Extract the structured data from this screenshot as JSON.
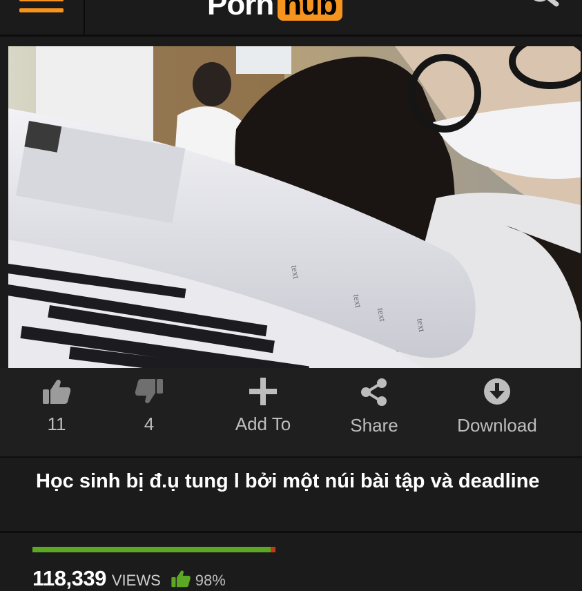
{
  "header": {
    "logo_left": "Porn",
    "logo_right": "hub",
    "icons": {
      "menu": "hamburger-menu-icon",
      "search": "search-icon"
    },
    "accent_color": "#f7941d"
  },
  "video": {
    "description": "selfie photo of students in white uniforms behind a stack of papers"
  },
  "actions": [
    {
      "icon": "thumbs-up-icon",
      "label": "11"
    },
    {
      "icon": "thumbs-down-icon",
      "label": "4"
    },
    {
      "icon": "plus-icon",
      "label": "Add To"
    },
    {
      "icon": "share-icon",
      "label": "Share"
    },
    {
      "icon": "download-icon",
      "label": "Download"
    }
  ],
  "title": "Học sinh bị đ.ụ tung l bởi một núi bài tập và deadline",
  "stats": {
    "views": "118,339",
    "views_label": "VIEWS",
    "rating_percent": "98%",
    "rating_fraction": 0.98,
    "good_color": "#5ca825",
    "bad_color": "#c23a12"
  }
}
